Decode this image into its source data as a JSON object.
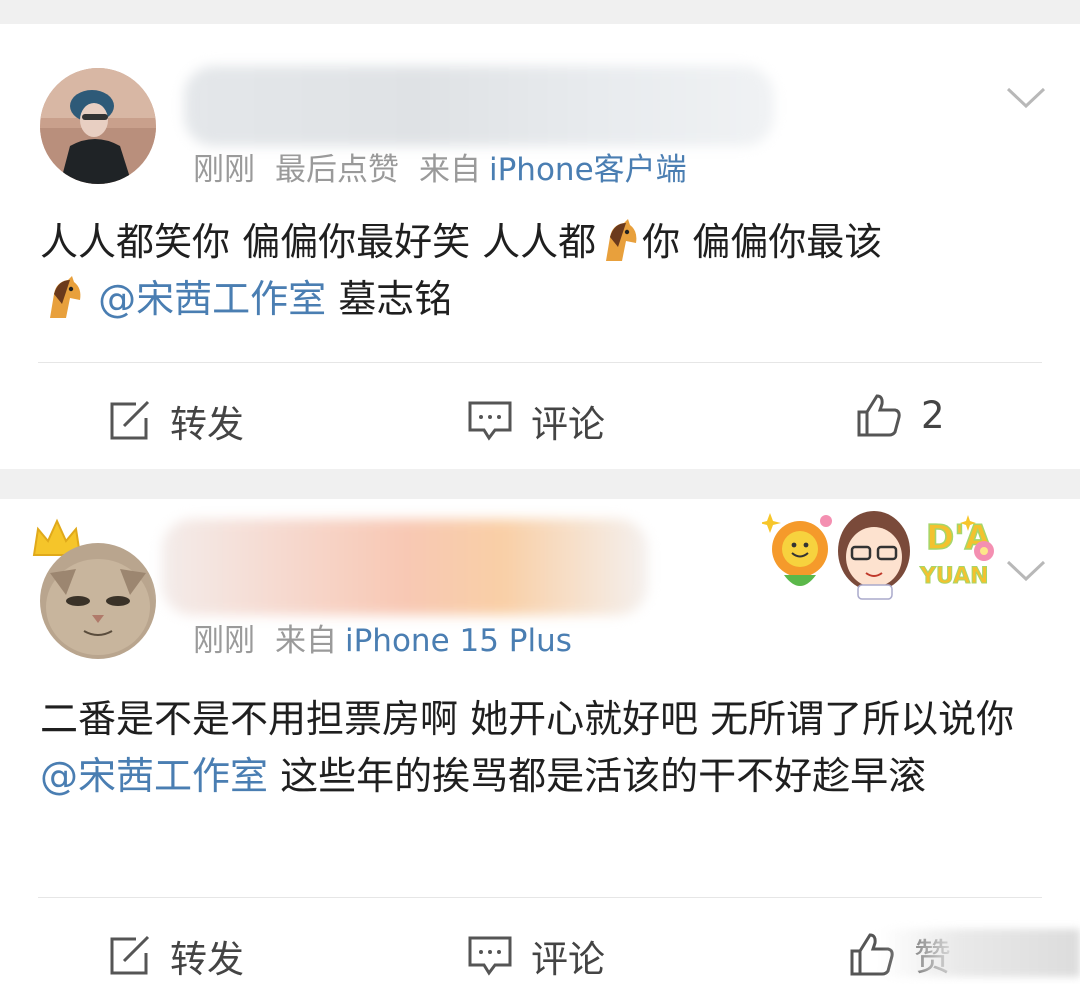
{
  "posts": [
    {
      "time": "刚刚",
      "liked_note": "最后点赞",
      "source_prefix": "来自",
      "source": "iPhone客户端",
      "text_part1": "人人都笑你 偏偏你最好笑 人人都",
      "emoji": "horse-emoji",
      "text_part2": "你 偏偏你最该",
      "mention": "@宋茜工作室",
      "text_part3": " 墓志铭",
      "actions": {
        "repost": "转发",
        "comment": "评论",
        "like_count": "2"
      }
    },
    {
      "time": "刚刚",
      "source_prefix": "来自",
      "source": "iPhone 15 Plus",
      "badge": "DA YUAN",
      "text_part1": "二番是不是不用担票房啊 她开心就好吧 无所谓了所以说你",
      "mention": "@宋茜工作室",
      "text_part2": " 这些年的挨骂都是活该的干不好趁早滚",
      "actions": {
        "repost": "转发",
        "comment": "评论",
        "like_label": "赞"
      }
    }
  ],
  "colors": {
    "link": "#4a7eb2",
    "meta": "#9a9a9a",
    "separator": "#f0f0f0"
  }
}
